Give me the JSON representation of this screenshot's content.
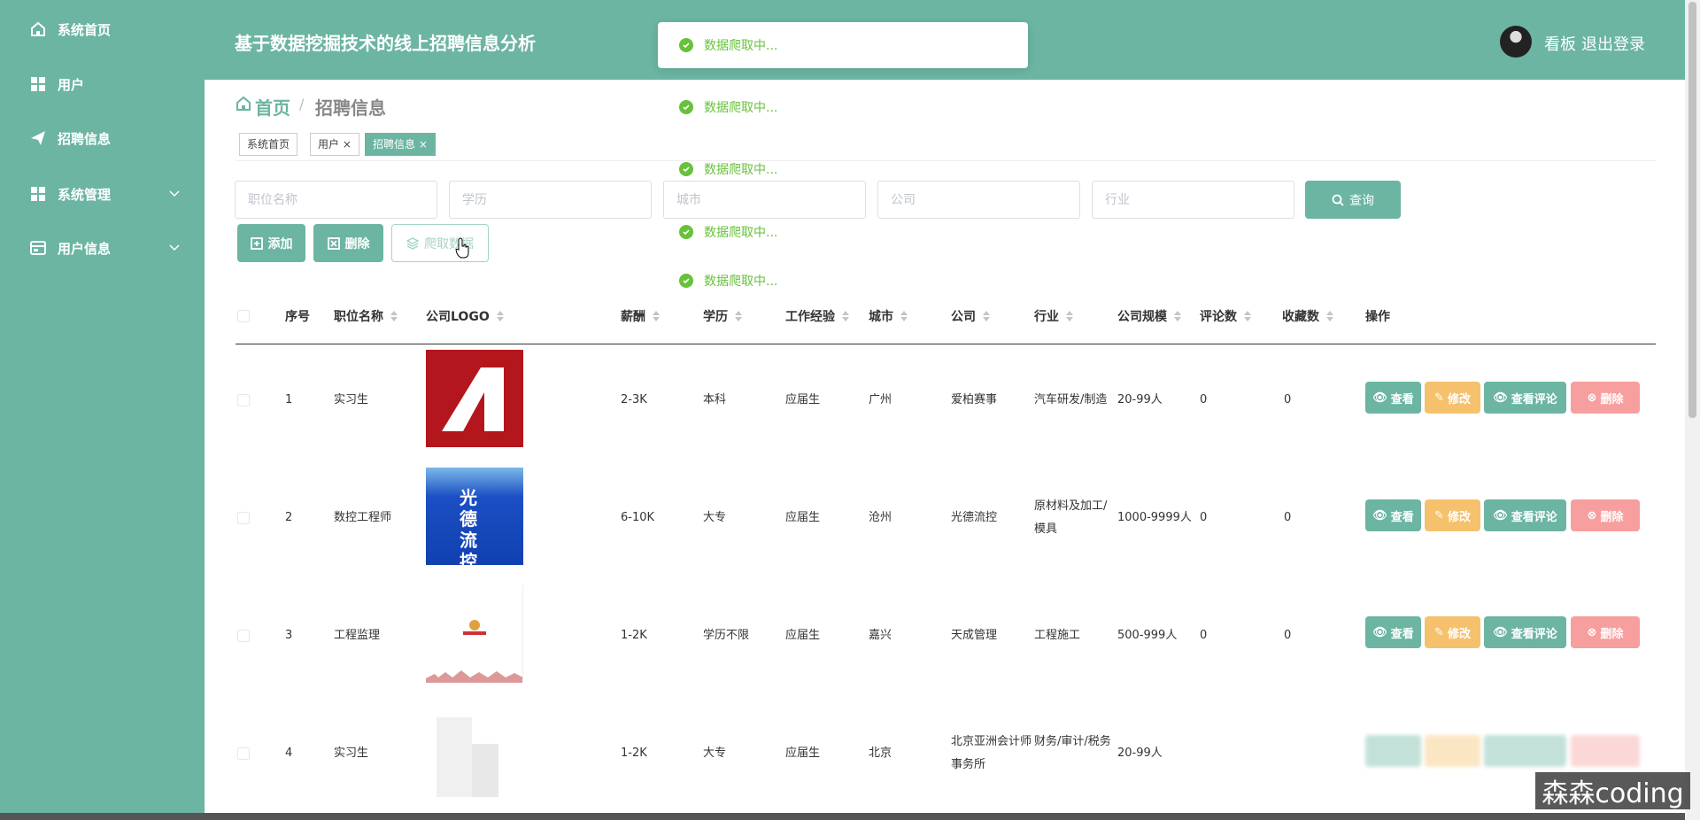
{
  "sidebar": {
    "items": [
      {
        "label": "系统首页",
        "icon": "home-icon"
      },
      {
        "label": "用户",
        "icon": "grid-icon"
      },
      {
        "label": "招聘信息",
        "icon": "paper-plane-icon"
      },
      {
        "label": "系统管理",
        "icon": "grid-icon"
      },
      {
        "label": "用户信息",
        "icon": "card-icon"
      }
    ]
  },
  "header": {
    "title": "基于数据挖掘技术的线上招聘信息分析",
    "kanban": "看板",
    "logout": "退出登录"
  },
  "breadcrumb": {
    "home": "首页",
    "separator": "/",
    "current": "招聘信息"
  },
  "tags": [
    {
      "label": "系统首页"
    },
    {
      "label": "用户 ×"
    },
    {
      "label": "招聘信息 ×"
    }
  ],
  "search": {
    "job_placeholder": "职位名称",
    "edu_placeholder": "学历",
    "city_placeholder": "城市",
    "company_placeholder": "公司",
    "industry_placeholder": "行业",
    "query_label": "查询"
  },
  "actions": {
    "add": "添加",
    "delete": "删除",
    "crawl": "爬取数据"
  },
  "toasts": [
    "数据爬取中...",
    "数据爬取中...",
    "数据爬取中...",
    "数据爬取中...",
    "数据爬取中..."
  ],
  "table": {
    "headers": {
      "index": "序号",
      "job": "职位名称",
      "logo": "公司LOGO",
      "salary": "薪酬",
      "edu": "学历",
      "exp": "工作经验",
      "city": "城市",
      "company": "公司",
      "industry": "行业",
      "size": "公司规模",
      "comments": "评论数",
      "favorites": "收藏数",
      "ops": "操作"
    },
    "op_labels": {
      "view": "查看",
      "edit": "修改",
      "comments": "查看评论",
      "delete": "删除"
    },
    "rows": [
      {
        "index": "1",
        "job": "实习生",
        "logo_text": "",
        "salary": "2-3K",
        "edu": "本科",
        "exp": "应届生",
        "city": "广州",
        "company": "爱柏赛事",
        "industry": "汽车研发/制造",
        "size": "20-99人",
        "comments": "0",
        "favorites": "0"
      },
      {
        "index": "2",
        "job": "数控工程师",
        "logo_text": "光德流控",
        "salary": "6-10K",
        "edu": "大专",
        "exp": "应届生",
        "city": "沧州",
        "company": "光德流控",
        "industry": "原材料及加工/模具",
        "size": "1000-9999人",
        "comments": "0",
        "favorites": "0"
      },
      {
        "index": "3",
        "job": "工程监理",
        "logo_text": "",
        "salary": "1-2K",
        "edu": "学历不限",
        "exp": "应届生",
        "city": "嘉兴",
        "company": "天成管理",
        "industry": "工程施工",
        "size": "500-999人",
        "comments": "0",
        "favorites": "0"
      },
      {
        "index": "4",
        "job": "实习生",
        "logo_text": "",
        "salary": "1-2K",
        "edu": "大专",
        "exp": "应届生",
        "city": "北京",
        "company": "北京亚洲会计师事务所",
        "industry": "财务/审计/税务",
        "size": "20-99人",
        "comments": "",
        "favorites": ""
      }
    ]
  },
  "watermark": "森森coding",
  "colors": {
    "primary": "#6bb5a2",
    "edit": "#f6c16d",
    "delete": "#f79e9e",
    "success": "#67c23a"
  }
}
